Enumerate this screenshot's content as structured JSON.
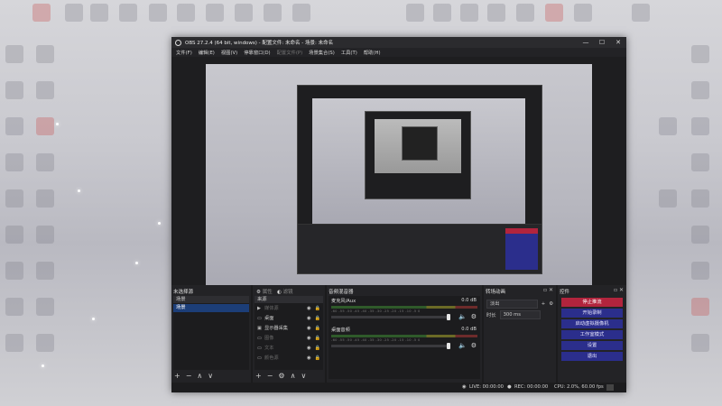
{
  "window": {
    "title": "OBS 27.2.4 (64 bit, windows) - 配置文件: 未命名 - 场景: 未命名",
    "controls": [
      "—",
      "☐",
      "✕"
    ]
  },
  "menu": [
    {
      "label": "文件(F)",
      "enabled": true
    },
    {
      "label": "编辑(E)",
      "enabled": true
    },
    {
      "label": "视图(V)",
      "enabled": true
    },
    {
      "label": "停靠窗口(D)",
      "enabled": true
    },
    {
      "label": "配置文件(P)",
      "enabled": false
    },
    {
      "label": "场景集合(S)",
      "enabled": true
    },
    {
      "label": "工具(T)",
      "enabled": true
    },
    {
      "label": "帮助(H)",
      "enabled": true
    }
  ],
  "docks": {
    "scenes": {
      "title": "未选择源",
      "header": "场景",
      "items": [
        "场景"
      ],
      "selected": 0
    },
    "sources": {
      "tabs": [
        "属性",
        "滤镜"
      ],
      "header": "来源",
      "items": [
        {
          "icon": "play-icon",
          "label": "媒体源",
          "dim": true
        },
        {
          "icon": "window-icon",
          "label": "桌面",
          "dim": false
        },
        {
          "icon": "monitor-icon",
          "label": "显示器采集",
          "dim": false
        },
        {
          "icon": "window-icon",
          "label": "图像",
          "dim": true
        },
        {
          "icon": "window-icon",
          "label": "文本",
          "dim": true
        },
        {
          "icon": "window-icon",
          "label": "颜色源",
          "dim": true
        }
      ]
    },
    "mixer": {
      "title": "音频混音器",
      "channels": [
        {
          "name": "麦克风/Aux",
          "db": "0.0 dB",
          "level": 1.0
        },
        {
          "name": "桌面音频",
          "db": "0.0 dB",
          "level": 1.0
        }
      ],
      "scale": "-60 -55 -50 -45 -40 -35 -30 -25 -20 -15 -10 -5 0"
    },
    "transitions": {
      "title": "转场动画",
      "type": "淡出",
      "duration_label": "时长",
      "duration": "300 ms"
    },
    "controls": {
      "title": "控件",
      "buttons": [
        {
          "label": "停止推流",
          "style": "stop"
        },
        {
          "label": "开始录制",
          "style": "normal"
        },
        {
          "label": "启动虚拟摄像机",
          "style": "normal"
        },
        {
          "label": "工作室模式",
          "style": "normal"
        },
        {
          "label": "设置",
          "style": "normal"
        },
        {
          "label": "退出",
          "style": "normal"
        }
      ]
    }
  },
  "status": {
    "live": "LIVE: 00:00:00",
    "rec": "REC: 00:00:00",
    "cpu": "CPU: 2.0%, 60.00 fps"
  },
  "colors": {
    "accent_blue": "#2b2e8c",
    "stop_red": "#b2243d",
    "selection": "#1c3e78"
  }
}
